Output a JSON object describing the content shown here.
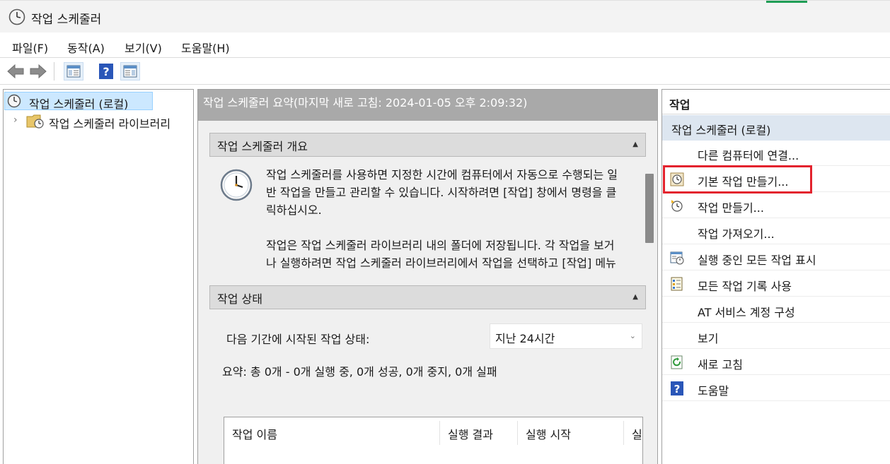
{
  "window": {
    "title": "작업 스케줄러",
    "accent": "#1f9d55"
  },
  "menubar": {
    "items": [
      "파일(F)",
      "동작(A)",
      "보기(V)",
      "도움말(H)"
    ]
  },
  "toolbar": {
    "buttons": [
      "back-arrow-icon",
      "forward-arrow-icon",
      "show-hide-console-tree-icon",
      "help-icon",
      "show-hide-action-pane-icon"
    ]
  },
  "tree": {
    "root": "작업 스케줄러 (로컬)",
    "child": "작업 스케줄러 라이브러리"
  },
  "main": {
    "header": "작업 스케줄러 요약(마지막 새로 고침: 2024-01-05 오후 2:09:32)",
    "overview": {
      "title": "작업 스케줄러 개요",
      "para1": "작업 스케줄러를 사용하면 지정한 시간에 컴퓨터에서 자동으로 수행되는 일반 작업을 만들고 관리할 수 있습니다. 시작하려면 [작업] 창에서 명령을 클릭하십시오.",
      "para2": "작업은 작업 스케줄러 라이브러리 내의 폴더에 저장됩니다. 각 작업을 보거나 실행하려면 작업 스케줄러 라이브러리에서 작업을 선택하고 [작업] 메뉴에서 명령을 클릭하십시오."
    },
    "status": {
      "title": "작업 상태",
      "period_label": "다음 기간에 시작된 작업 상태:",
      "period_value": "지난 24시간",
      "summary": "요약: 총 0개 - 0개 실행 중, 0개 성공, 0개 중지, 0개 실패",
      "columns": [
        "작업 이름",
        "실행 결과",
        "실행 시작",
        "실"
      ]
    }
  },
  "actions": {
    "title": "작업",
    "section": "작업 스케줄러 (로컬)",
    "items": [
      {
        "label": "다른 컴퓨터에 연결...",
        "icon": ""
      },
      {
        "label": "기본 작업 만들기...",
        "icon": "basic-task-wizard-icon"
      },
      {
        "label": "작업 만들기...",
        "icon": "create-task-icon"
      },
      {
        "label": "작업 가져오기...",
        "icon": ""
      },
      {
        "label": "실행 중인 모든 작업 표시",
        "icon": "running-tasks-icon"
      },
      {
        "label": "모든 작업 기록 사용",
        "icon": "task-history-icon"
      },
      {
        "label": "AT 서비스 계정 구성",
        "icon": ""
      },
      {
        "label": "보기",
        "icon": ""
      },
      {
        "label": "새로 고침",
        "icon": "refresh-icon"
      },
      {
        "label": "도움말",
        "icon": "help-icon"
      }
    ],
    "highlight_color": "#e3222d"
  }
}
